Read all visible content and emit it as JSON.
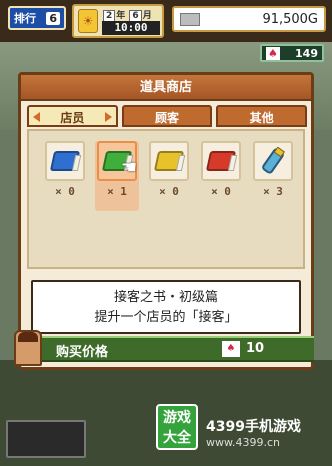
{
  "hud": {
    "rank_label": "排行",
    "rank_value": "6",
    "year_value": "2",
    "year_unit": "年",
    "month_value": "6",
    "month_unit": "月",
    "clock": "10:00",
    "money": "91,500G",
    "points": "149"
  },
  "panel": {
    "title": "道具商店",
    "tabs": [
      {
        "label": "店员"
      },
      {
        "label": "顾客"
      },
      {
        "label": "其他"
      }
    ],
    "items": [
      {
        "color": "#2f6fd0",
        "count": "× 0"
      },
      {
        "color": "#3fae3a",
        "count": "× 1"
      },
      {
        "color": "#e8c22a",
        "count": "× 0"
      },
      {
        "color": "#d63a2a",
        "count": "× 0"
      },
      {
        "color": "#5bb0d8",
        "count": "× 3"
      }
    ],
    "description": {
      "line1": "接客之书・初级篇",
      "line2": "提升一个店员的「接客」"
    }
  },
  "price": {
    "label": "购买价格",
    "value": "10"
  },
  "watermark": {
    "logo_line1": "游戏",
    "logo_line2": "大全",
    "site_name": "4399手机游戏",
    "site_url": "www.4399.cn"
  }
}
